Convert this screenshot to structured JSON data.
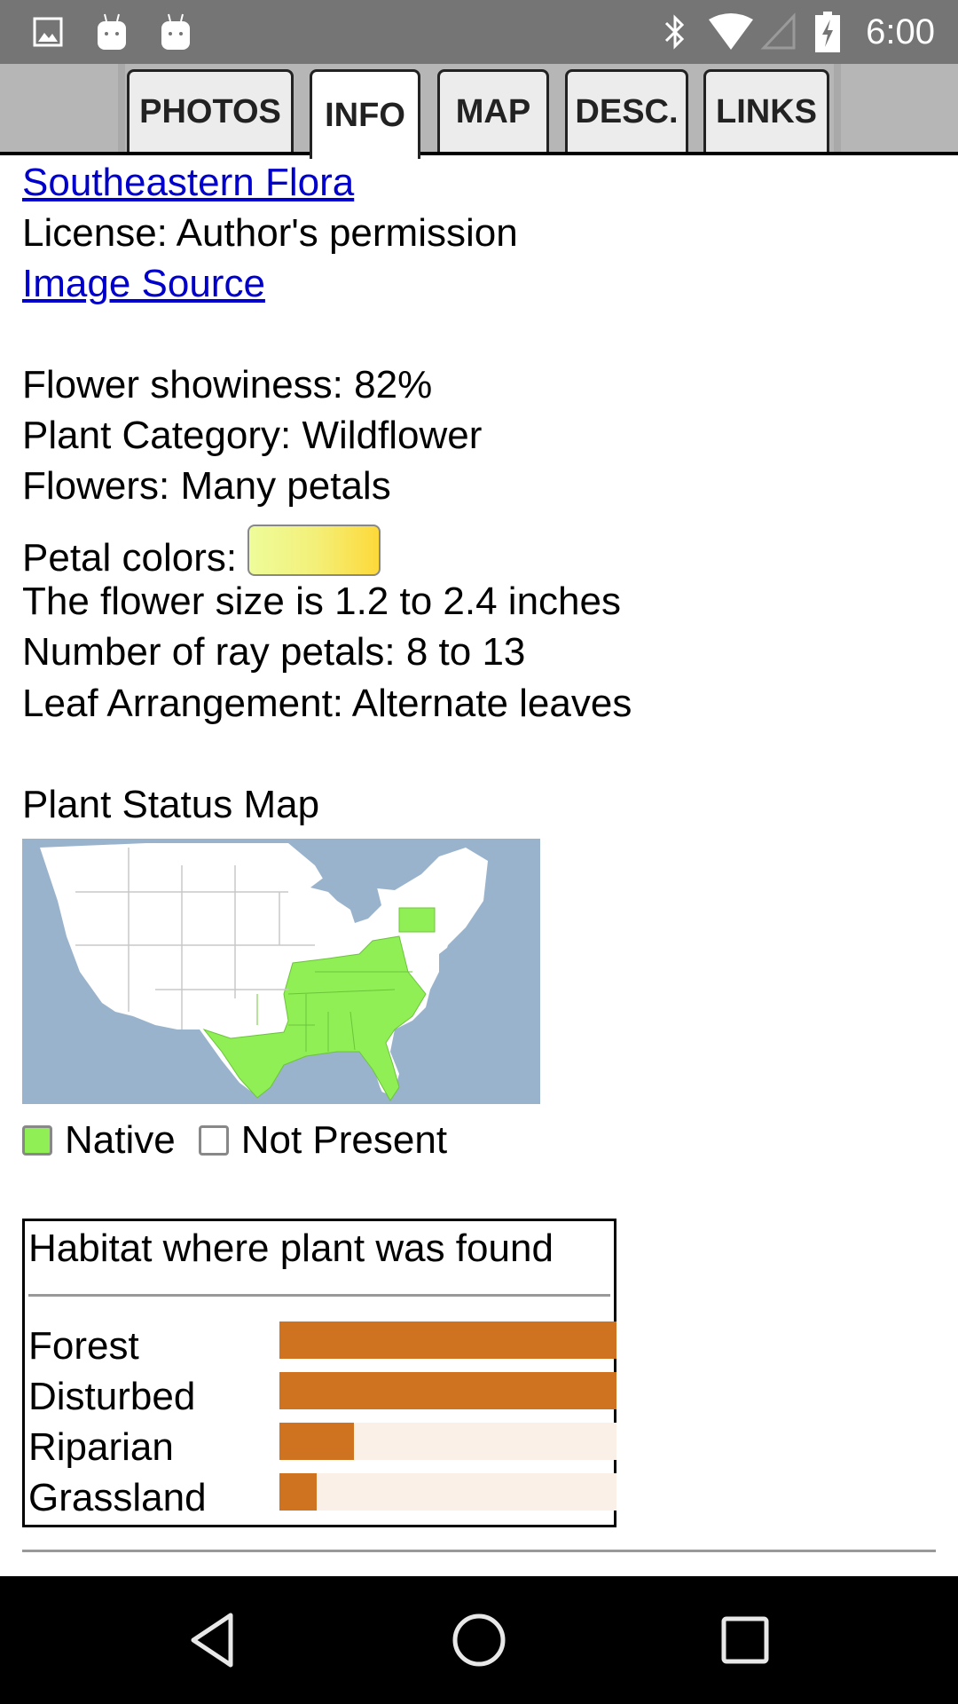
{
  "status_bar": {
    "time": "6:00",
    "left_icons": [
      "image-notification-icon",
      "android-notification-icon",
      "android-notification-icon"
    ],
    "right_icons": [
      "bluetooth-icon",
      "wifi-icon",
      "cell-signal-icon",
      "battery-charging-icon"
    ]
  },
  "tabs": [
    {
      "label": "PHOTOS",
      "active": false
    },
    {
      "label": "INFO",
      "active": true
    },
    {
      "label": "MAP",
      "active": false
    },
    {
      "label": "DESC.",
      "active": false
    },
    {
      "label": "LINKS",
      "active": false
    }
  ],
  "info": {
    "source_link": "Southeastern Flora",
    "license": "License: Author's permission",
    "image_source_link": "Image Source",
    "showiness": "Flower showiness: 82%",
    "category": "Plant Category: Wildflower",
    "flowers": "Flowers: Many petals",
    "petal_colors_label": "Petal colors:",
    "petal_colors": [
      "#eefc9a",
      "#fdd93a"
    ],
    "flower_size": "The flower size is 1.2 to 2.4 inches",
    "ray_petals": "Number of ray petals: 8 to 13",
    "leaf_arrangement": "Leaf Arrangement: Alternate leaves"
  },
  "status_map": {
    "title": "Plant Status Map",
    "native_color": "#8fef55",
    "water_color": "#9ab3cc",
    "native_states": [
      "TX",
      "OK",
      "AR",
      "LA",
      "MO",
      "MS",
      "AL",
      "GA",
      "FL",
      "SC",
      "NC",
      "TN",
      "KY",
      "VA",
      "WV",
      "PA"
    ],
    "legend": [
      {
        "label": "Native",
        "color": "#8fef55"
      },
      {
        "label": "Not Present",
        "color": "#ffffff"
      }
    ]
  },
  "habitat": {
    "title": "Habitat where plant was found",
    "bar_color": "#cf7320",
    "track_color": "#fbf0e8",
    "rows": [
      {
        "label": "Forest",
        "fraction": 1.0
      },
      {
        "label": "Disturbed",
        "fraction": 1.0
      },
      {
        "label": "Riparian",
        "fraction": 0.22
      },
      {
        "label": "Grassland",
        "fraction": 0.11
      }
    ]
  },
  "nav_bar": {
    "buttons": [
      "back",
      "home",
      "recents"
    ]
  }
}
